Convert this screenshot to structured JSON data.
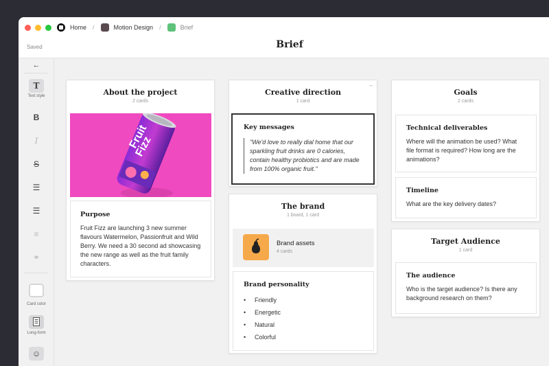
{
  "window": {
    "dots": [
      "#ff5f57",
      "#febc2e",
      "#28c840"
    ],
    "breadcrumbs": [
      {
        "label": "Home",
        "color": "#111111",
        "icon": "milanote-logo-icon"
      },
      {
        "label": "Motion Design",
        "color": "#5a4a50",
        "icon": "board-icon"
      },
      {
        "label": "Brief",
        "color": "#5fc27a",
        "icon": "board-icon"
      }
    ],
    "saved_label": "Saved",
    "title": "Brief"
  },
  "toolbar": {
    "back": "←",
    "text_style": {
      "glyph": "T",
      "label": "Text style"
    },
    "bold": "B",
    "italic": "I",
    "strike": "S",
    "bullets": "☰",
    "numbered": "☰",
    "align": "≡",
    "link": "⚭",
    "card_color": {
      "label": "Card color"
    },
    "long_form": {
      "label": "Long-form"
    },
    "emoji": "☺"
  },
  "columns": {
    "about": {
      "title": "About the project",
      "sub": "2 cards",
      "image": {
        "alt": "Fruit Fizz can",
        "brand": "Fruit",
        "brand2": "Fizz",
        "bg": "#f04ac0"
      },
      "purpose": {
        "title": "Purpose",
        "body": "Fruit Fizz are launching 3 new summer flavours Watermelon, Passionfruit and Wild Berry. We need a 30 second ad showcasing the new range as well as the fruit family characters."
      }
    },
    "creative": {
      "title": "Creative direction",
      "sub": "1 card",
      "key": {
        "title": "Key messages",
        "quote": "\"We'd love to really dial home that our sparkling fruit drinks are 0 calories, contain healthy probiotics and are made from 100% organic fruit.\""
      }
    },
    "brand": {
      "title": "The brand",
      "sub": "1 board, 1 card",
      "assets": {
        "title": "Brand assets",
        "sub": "4 cards",
        "icon": "pear-icon",
        "color": "#f6a94a"
      },
      "personality": {
        "title": "Brand personality",
        "items": [
          "Friendly",
          "Energetic",
          "Natural",
          "Colorful"
        ]
      }
    },
    "goals": {
      "title": "Goals",
      "sub": "2 cards",
      "tech": {
        "title": "Technical deliverables",
        "body": "Where will the animation be used? What file format is required? How long are the animations?"
      },
      "timeline": {
        "title": "Timeline",
        "body": "What are the key delivery dates?"
      }
    },
    "audience": {
      "title": "Target Audience",
      "sub": "1 card",
      "card": {
        "title": "The audience",
        "body": "Who is the target audience? Is there any background research on them?"
      }
    }
  }
}
